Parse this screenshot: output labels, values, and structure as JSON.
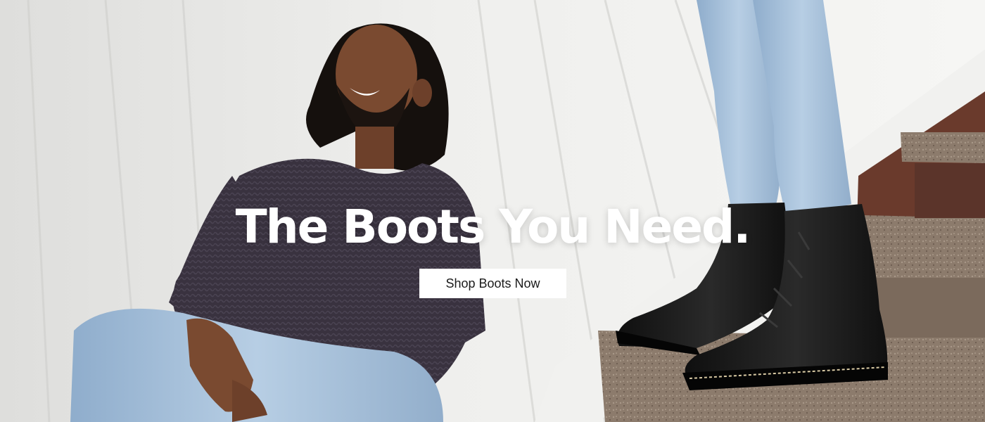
{
  "hero": {
    "headline": "The Boots You Need.",
    "cta_label": "Shop Boots Now"
  },
  "colors": {
    "headline_text": "#ffffff",
    "cta_background": "#ffffff",
    "cta_text": "#1b1b1b",
    "wall": "#ececea",
    "sweater": "#3a3441",
    "denim": "#a9c2dc",
    "boot_leather": "#141414",
    "stair_stone": "#7b6a5c"
  }
}
